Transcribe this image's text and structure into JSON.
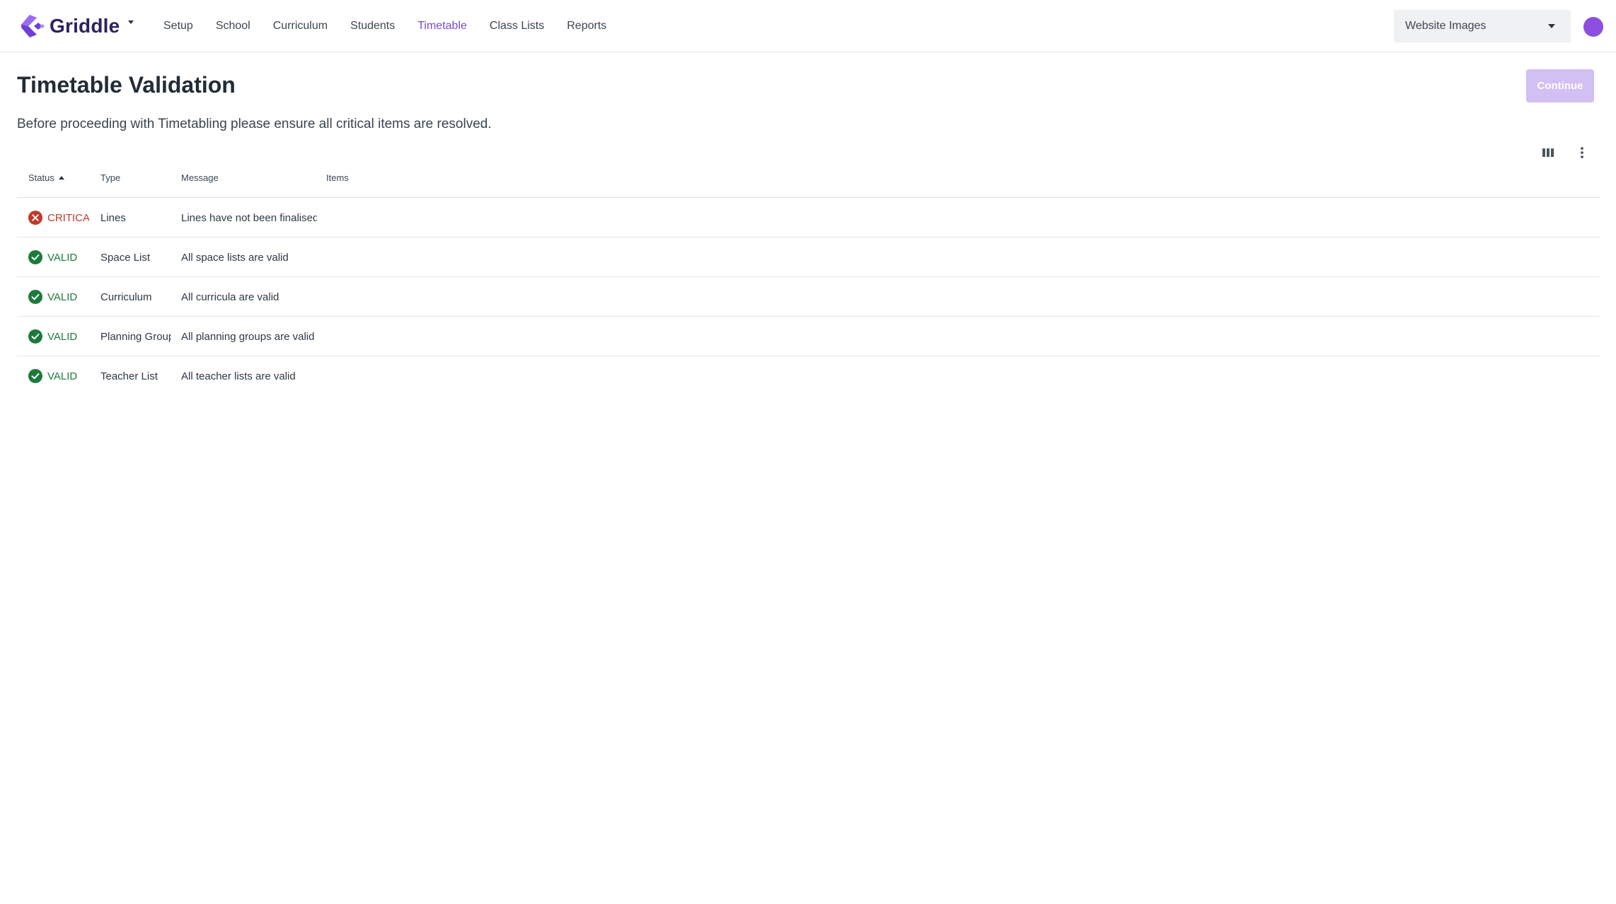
{
  "app": {
    "name": "Griddle"
  },
  "nav": {
    "items": [
      {
        "label": "Setup"
      },
      {
        "label": "School"
      },
      {
        "label": "Curriculum"
      },
      {
        "label": "Students"
      },
      {
        "label": "Timetable",
        "active": true
      },
      {
        "label": "Class Lists"
      },
      {
        "label": "Reports"
      }
    ]
  },
  "workspace": {
    "selected": "Website Images"
  },
  "page": {
    "title": "Timetable Validation",
    "subtitle": "Before proceeding with Timetabling please ensure all critical items are resolved.",
    "continue_label": "Continue"
  },
  "table": {
    "columns": [
      "Status",
      "Type",
      "Message",
      "Items"
    ],
    "sorted_column": "Status",
    "sort_direction": "ascending",
    "rows": [
      {
        "status": "CRITICAL",
        "type": "Lines",
        "message": "Lines have not been finalised",
        "items": ""
      },
      {
        "status": "VALID",
        "type": "Space List",
        "message": "All space lists are valid",
        "items": ""
      },
      {
        "status": "VALID",
        "type": "Curriculum",
        "message": "All curricula are valid",
        "items": ""
      },
      {
        "status": "VALID",
        "type": "Planning Groups",
        "message": "All planning groups are valid",
        "items": ""
      },
      {
        "status": "VALID",
        "type": "Teacher List",
        "message": "All teacher lists are valid",
        "items": ""
      }
    ]
  },
  "icons": {
    "logo": "griddle-logo-icon",
    "columns": "view-columns-icon",
    "more": "more-vertical-icon",
    "critical": "error-circle-icon",
    "valid": "check-circle-icon"
  },
  "colors": {
    "accent": "#7a48d8",
    "critical": "#c0392b",
    "valid": "#1e7a3c",
    "continue_disabled": "#d2bff3",
    "avatar": "#8c4fe0"
  }
}
